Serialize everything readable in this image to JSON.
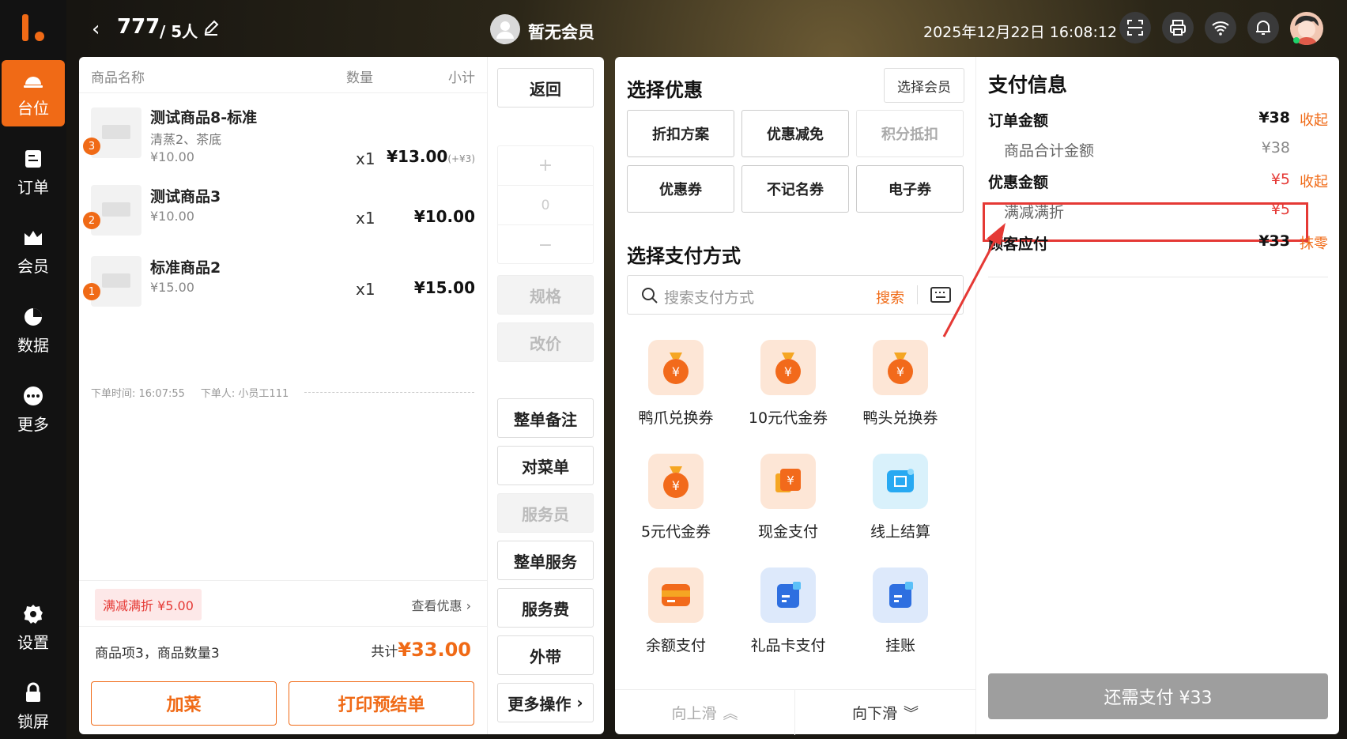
{
  "nav": {
    "items": [
      {
        "label": "台位",
        "icon": "table-icon"
      },
      {
        "label": "订单",
        "icon": "order-icon"
      },
      {
        "label": "会员",
        "icon": "member-icon"
      },
      {
        "label": "数据",
        "icon": "chart-icon"
      },
      {
        "label": "更多",
        "icon": "more-icon"
      },
      {
        "label": "设置",
        "icon": "gear-icon"
      },
      {
        "label": "锁屏",
        "icon": "lock-icon"
      }
    ]
  },
  "topbar": {
    "table_no": "777",
    "people": "/ 5人",
    "member": "暂无会员",
    "datetime": "2025年12月22日 16:08:12"
  },
  "order": {
    "headers": {
      "name": "商品名称",
      "qty": "数量",
      "subtotal": "小计"
    },
    "items": [
      {
        "badge": "3",
        "name": "测试商品8-标准",
        "sub": "清蒸2、茶底",
        "price": "¥10.00",
        "qty": "x1",
        "total": "¥13.00",
        "extra": "(+¥3)"
      },
      {
        "badge": "2",
        "name": "测试商品3",
        "sub": "",
        "price": "¥10.00",
        "qty": "x1",
        "total": "¥10.00",
        "extra": ""
      },
      {
        "badge": "1",
        "name": "标准商品2",
        "sub": "",
        "price": "¥15.00",
        "qty": "x1",
        "total": "¥15.00",
        "extra": ""
      }
    ],
    "meta_time": "下单时间: 16:07:55",
    "meta_user": "下单人: 小员工111",
    "promo_tag": "满减满折 ¥5.00",
    "promo_link": "查看优惠",
    "summary": "商品项3，商品数量3",
    "total_label": "共计",
    "total_value": "¥33.00",
    "add_button": "加菜",
    "print_button": "打印预结单"
  },
  "actions": {
    "back": "返回",
    "stepper_plus": "+",
    "stepper_value": "0",
    "stepper_minus": "−",
    "spec": "规格",
    "reprice": "改价",
    "note": "整单备注",
    "check": "对菜单",
    "waiter": "服务员",
    "service": "整单服务",
    "service_fee": "服务费",
    "takeaway": "外带",
    "more": "更多操作"
  },
  "discount": {
    "title": "选择优惠",
    "select_member": "选择会员",
    "buttons": [
      "折扣方案",
      "优惠减免",
      "积分抵扣",
      "优惠券",
      "不记名券",
      "电子券"
    ]
  },
  "payment": {
    "title": "选择支付方式",
    "search_placeholder": "搜索支付方式",
    "search_button": "搜索",
    "methods": [
      {
        "label": "鸭爪兑换券",
        "icon": "money-bag-icon"
      },
      {
        "label": "10元代金券",
        "icon": "money-bag-icon"
      },
      {
        "label": "鸭头兑换券",
        "icon": "money-bag-icon"
      },
      {
        "label": "5元代金券",
        "icon": "money-bag-icon"
      },
      {
        "label": "现金支付",
        "icon": "cash-icon"
      },
      {
        "label": "线上结算",
        "icon": "scan-pay-icon"
      },
      {
        "label": "余额支付",
        "icon": "wallet-icon"
      },
      {
        "label": "礼品卡支付",
        "icon": "gift-card-icon"
      },
      {
        "label": "挂账",
        "icon": "credit-icon"
      }
    ],
    "scroll_up": "向上滑",
    "scroll_down": "向下滑"
  },
  "info": {
    "title": "支付信息",
    "order_amount_label": "订单金额",
    "order_amount": "¥38",
    "collapse1": "收起",
    "goods_total_label": "商品合计金额",
    "goods_total": "¥38",
    "discount_label": "优惠金额",
    "discount_amount": "¥5",
    "collapse2": "收起",
    "promo_label": "满减满折",
    "promo_amount": "¥5",
    "due_label": "顾客应付",
    "due_amount": "¥33",
    "round": "抹零",
    "pay_button": "还需支付 ¥33"
  }
}
